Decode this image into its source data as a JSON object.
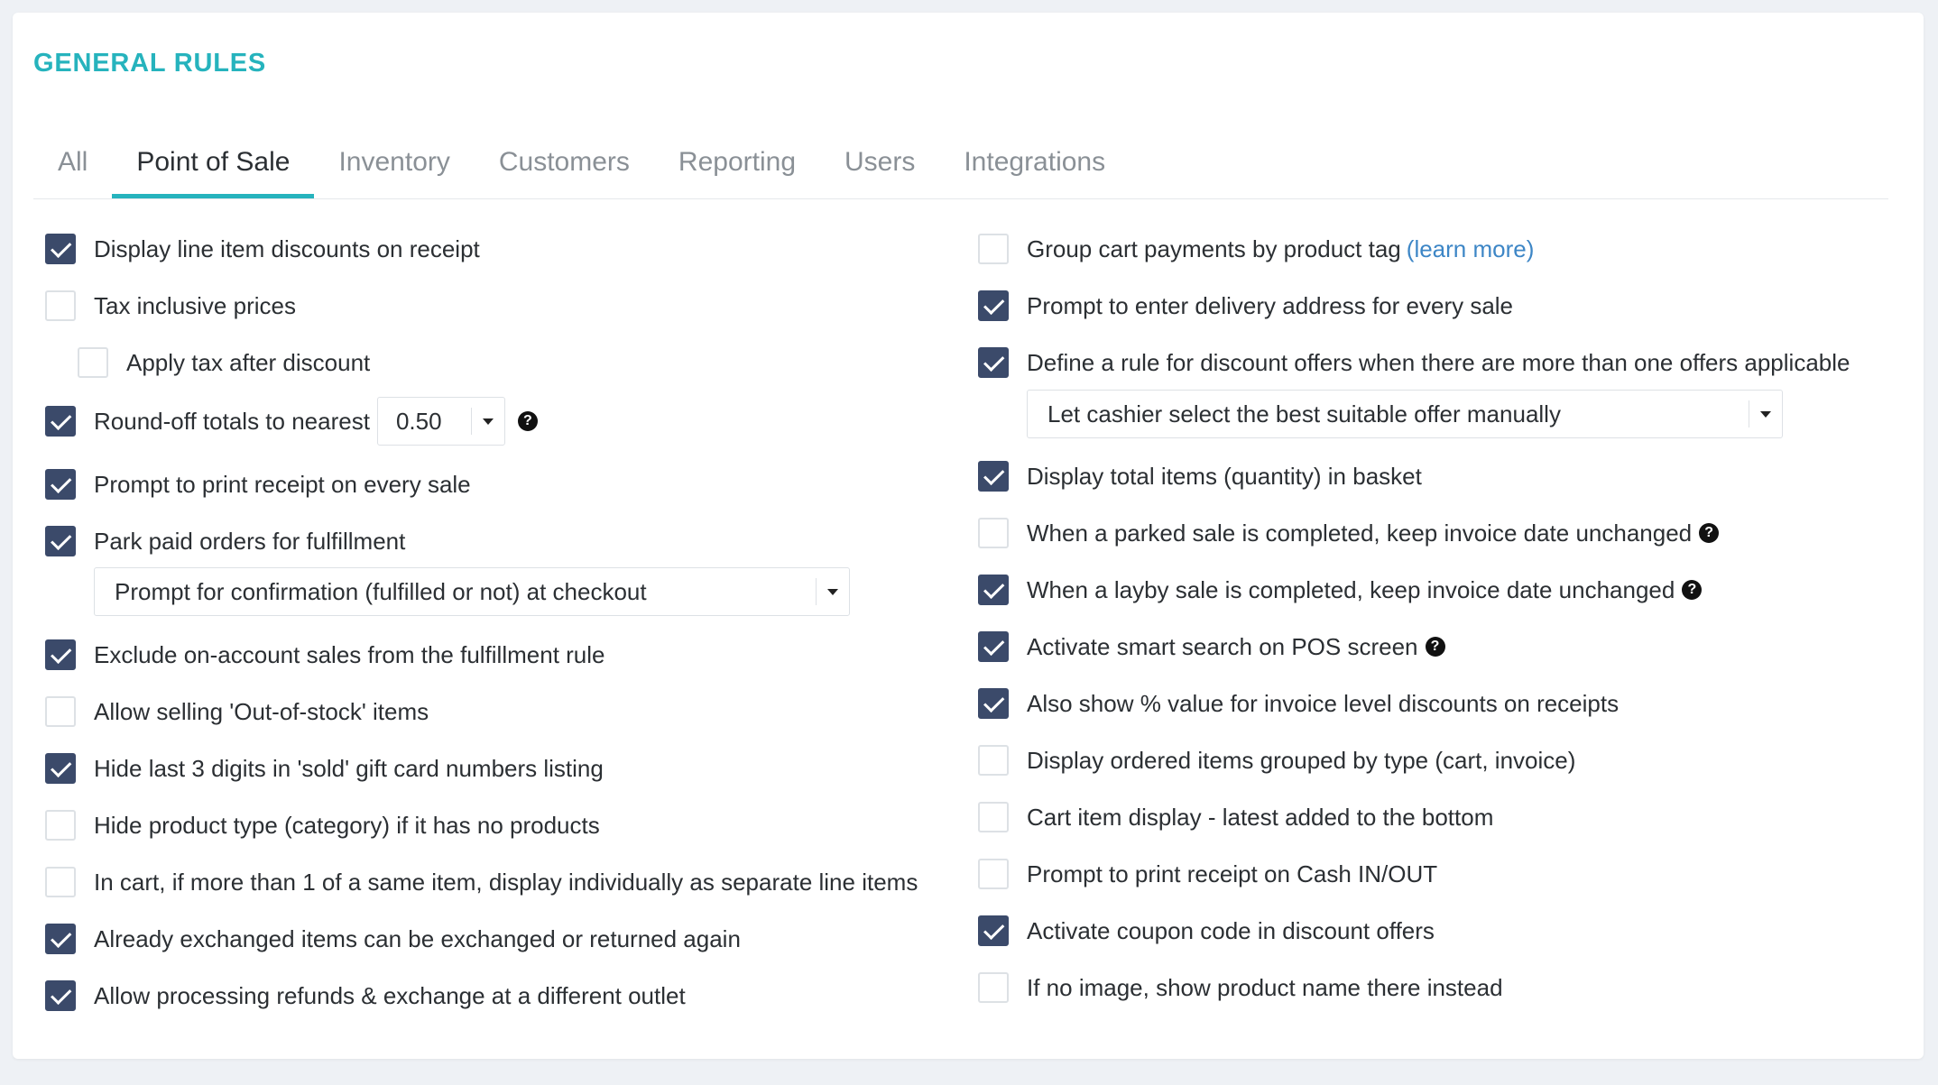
{
  "page": {
    "title": "GENERAL RULES"
  },
  "tabs": [
    {
      "label": "All"
    },
    {
      "label": "Point of Sale"
    },
    {
      "label": "Inventory"
    },
    {
      "label": "Customers"
    },
    {
      "label": "Reporting"
    },
    {
      "label": "Users"
    },
    {
      "label": "Integrations"
    }
  ],
  "active_tab": "Point of Sale",
  "left": {
    "display_line_item_discounts": {
      "label": "Display line item discounts on receipt",
      "checked": true
    },
    "tax_inclusive": {
      "label": "Tax inclusive prices",
      "checked": false
    },
    "apply_tax_after_discount": {
      "label": "Apply tax after discount",
      "checked": false
    },
    "round_off": {
      "label": "Round-off totals to nearest",
      "checked": true,
      "value": "0.50"
    },
    "prompt_print_receipt": {
      "label": "Prompt to print receipt on every sale",
      "checked": true
    },
    "park_paid_orders": {
      "label": "Park paid orders for fulfillment",
      "checked": true
    },
    "fulfillment_select": {
      "value": "Prompt for confirmation (fulfilled or not) at checkout"
    },
    "exclude_on_account": {
      "label": "Exclude on-account sales from the fulfillment rule",
      "checked": true
    },
    "allow_out_of_stock": {
      "label": "Allow selling 'Out-of-stock' items",
      "checked": false
    },
    "hide_gift_card_digits": {
      "label": "Hide last 3 digits in 'sold' gift card numbers listing",
      "checked": true
    },
    "hide_product_type": {
      "label": "Hide product type (category) if it has no products",
      "checked": false
    },
    "separate_line_items": {
      "label": "In cart, if more than 1 of a same item, display individually as separate line items",
      "checked": false
    },
    "exchange_again": {
      "label": "Already exchanged items can be exchanged or returned again",
      "checked": true
    },
    "refunds_different_outlet": {
      "label": "Allow processing refunds & exchange at a different outlet",
      "checked": true
    }
  },
  "right": {
    "group_cart_payments": {
      "label": "Group cart payments by product tag",
      "link": "(learn more)",
      "checked": false
    },
    "prompt_delivery_address": {
      "label": "Prompt to enter delivery address for every sale",
      "checked": true
    },
    "define_discount_rule": {
      "label": "Define a rule for discount offers when there are more than one offers applicable",
      "checked": true
    },
    "discount_rule_select": {
      "value": "Let cashier select the best suitable offer manually"
    },
    "display_total_items": {
      "label": "Display total items (quantity) in basket",
      "checked": true
    },
    "parked_sale_date": {
      "label": "When a parked sale is completed, keep invoice date unchanged",
      "checked": false
    },
    "layby_sale_date": {
      "label": "When a layby sale is completed, keep invoice date unchanged",
      "checked": true
    },
    "smart_search": {
      "label": "Activate smart search on POS screen",
      "checked": true
    },
    "show_percent_value": {
      "label": "Also show % value for invoice level discounts on receipts",
      "checked": true
    },
    "grouped_by_type": {
      "label": "Display ordered items grouped by type (cart, invoice)",
      "checked": false
    },
    "latest_added_bottom": {
      "label": "Cart item display - latest added to the bottom",
      "checked": false
    },
    "print_receipt_cash": {
      "label": "Prompt to print receipt on Cash IN/OUT",
      "checked": false
    },
    "coupon_code": {
      "label": "Activate coupon code in discount offers",
      "checked": true
    },
    "no_image_name": {
      "label": "If no image, show product name there instead",
      "checked": false
    }
  },
  "icons": {
    "help": "question-circle-icon",
    "check": "checkmark-icon",
    "caret": "caret-down-icon"
  },
  "colors": {
    "accent": "#26b3bd",
    "checkbox_checked": "#3b4a6a",
    "link": "#3d86c6"
  }
}
